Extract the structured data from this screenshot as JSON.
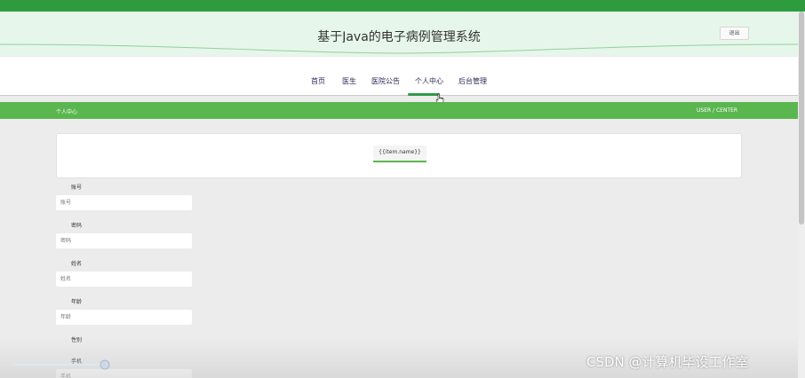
{
  "header": {
    "title": "基于Java的电子病例管理系统",
    "logout_label": "退出"
  },
  "nav": {
    "items": [
      {
        "label": "首页"
      },
      {
        "label": "医生"
      },
      {
        "label": "医院公告"
      },
      {
        "label": "个人中心"
      },
      {
        "label": "后台管理"
      }
    ],
    "active_index": 3
  },
  "section": {
    "title_left": "个人中心",
    "title_right": "USER / CENTER"
  },
  "tabs": [
    {
      "label": "{{item.name}}"
    }
  ],
  "form": {
    "fields": [
      {
        "label": "账号",
        "placeholder": "账号"
      },
      {
        "label": "密码",
        "placeholder": "密码"
      },
      {
        "label": "姓名",
        "placeholder": "姓名"
      },
      {
        "label": "年龄",
        "placeholder": "年龄"
      },
      {
        "label": "性别"
      },
      {
        "label": "手机",
        "placeholder": "手机"
      }
    ]
  },
  "watermark": "CSDN @计算机毕设工作室",
  "colors": {
    "primary_green": "#5ab64e",
    "top_strip": "#2e9c3e",
    "header_bg": "#e6f6ea",
    "nav_text": "#2a2a55"
  },
  "icons": [
    "pointer-cursor-icon"
  ]
}
